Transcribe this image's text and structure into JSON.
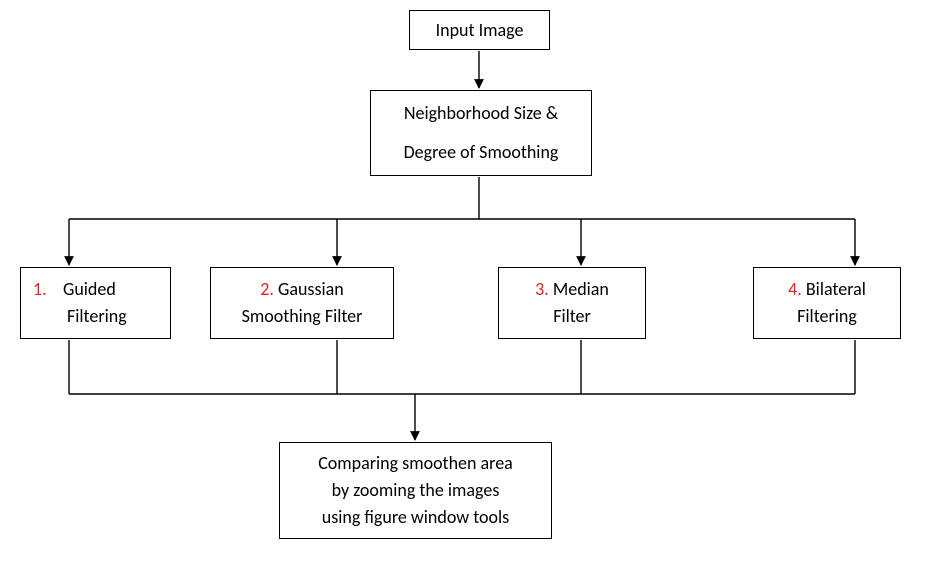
{
  "boxes": {
    "input": {
      "text": "Input Image"
    },
    "neighborhood": {
      "line1": "Neighborhood Size &",
      "line2": "Degree of Smoothing"
    },
    "f1": {
      "num": "1.",
      "label": "Guided Filtering"
    },
    "f2": {
      "num": "2.",
      "label": "Gaussian Smoothing Filter"
    },
    "f3": {
      "num": "3.",
      "label": "Median Filter"
    },
    "f4": {
      "num": "4.",
      "label": "Bilateral Filtering"
    },
    "compare": {
      "line1": "Comparing smoothen area",
      "line2": "by zooming the images",
      "line3": "using figure window tools"
    }
  }
}
